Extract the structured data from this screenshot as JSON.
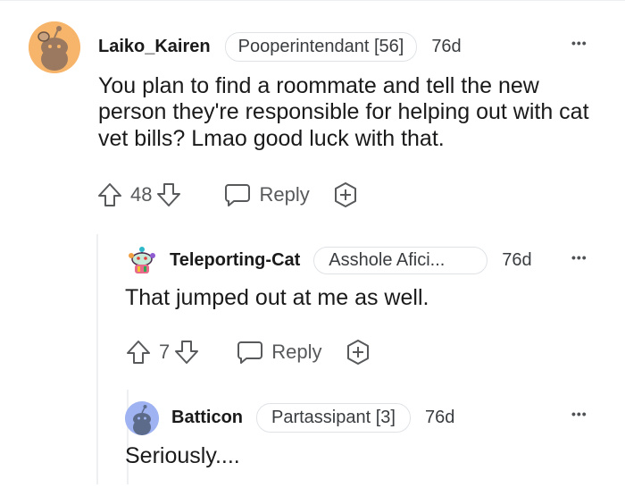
{
  "comments": [
    {
      "username": "Laiko_Kairen",
      "flair": "Pooperintendant [56]",
      "time": "76d",
      "body": "You plan to find a roommate and tell the new person they're responsible for helping out with cat vet bills? Lmao good luck with that.",
      "score": "48",
      "reply_label": "Reply",
      "avatar_icon": "snoo-avatar-orange"
    },
    {
      "username": "Teleporting-Cat",
      "flair": "Asshole Afici...",
      "time": "76d",
      "body": "That jumped out at me as well.",
      "score": "7",
      "reply_label": "Reply",
      "avatar_icon": "snoo-avatar-colorful"
    },
    {
      "username": "Batticon",
      "flair": "Partassipant [3]",
      "time": "76d",
      "body": "Seriously....",
      "avatar_icon": "snoo-avatar-blue"
    }
  ],
  "more_options": "•••",
  "colors": {
    "text": "#1a1a1b",
    "meta": "#57595b",
    "flair_border": "#e0e3e6",
    "thread_line": "#edeff1"
  }
}
